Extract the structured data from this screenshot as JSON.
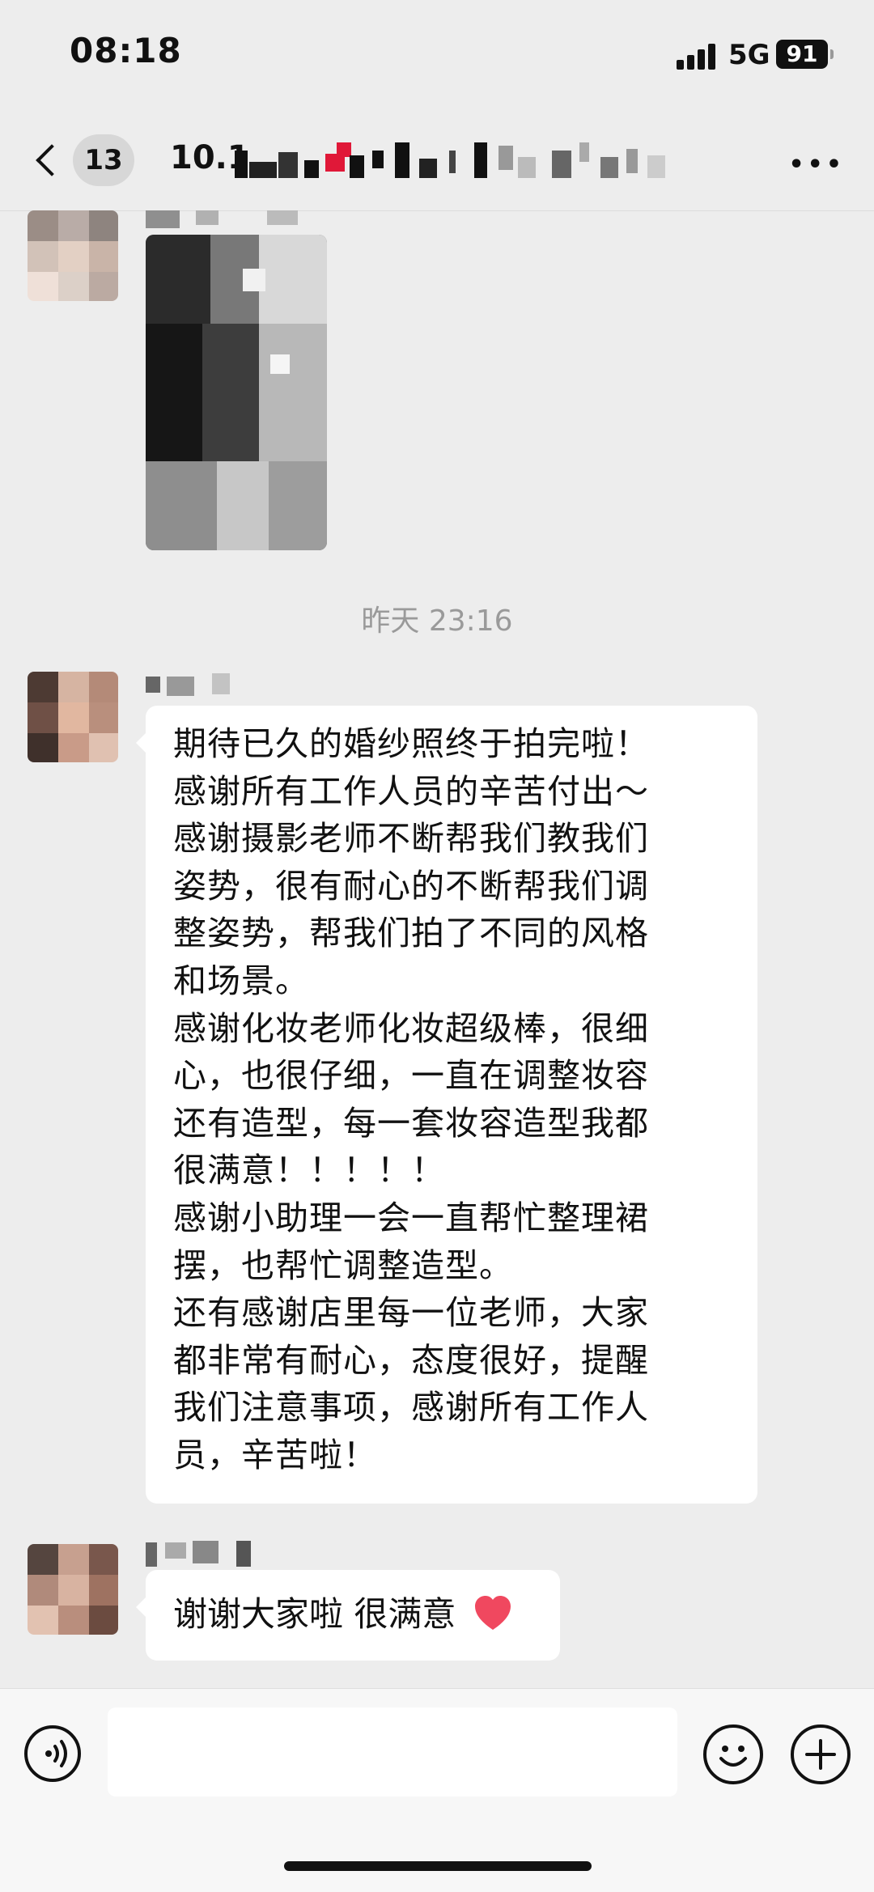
{
  "status_bar": {
    "time": "08:18",
    "network": "5G",
    "battery": "91"
  },
  "header": {
    "back_icon": "chevron-left-icon",
    "unread_count": "13",
    "title": "10.1",
    "more_icon": "more-icon"
  },
  "messages": {
    "time_divider": "昨天 23:16",
    "long_message_lines": [
      "期待已久的婚纱照终于拍完啦！",
      "感谢所有工作人员的辛苦付出～",
      "感谢摄影老师不断帮我们教我们",
      "姿势，很有耐心的不断帮我们调",
      "整姿势，帮我们拍了不同的风格",
      "和场景。",
      "感谢化妆老师化妆超级棒，很细",
      "心，也很仔细，一直在调整妆容",
      "还有造型，每一套妆容造型我都",
      "很满意！！！！！",
      "感谢小助理一会一直帮忙整理裙",
      "摆，也帮忙调整造型。",
      "还有感谢店里每一位老师，大家",
      "都非常有耐心，态度很好，提醒",
      "我们注意事项，感谢所有工作人",
      "员，辛苦啦！"
    ],
    "short_message": "谢谢大家啦 很满意"
  },
  "input_bar": {
    "voice_icon": "voice-icon",
    "emoji_icon": "emoji-icon",
    "plus_icon": "plus-icon",
    "input_value": ""
  },
  "colors": {
    "background": "#ededed",
    "bubble": "#ffffff",
    "heart": "#f0485f"
  }
}
